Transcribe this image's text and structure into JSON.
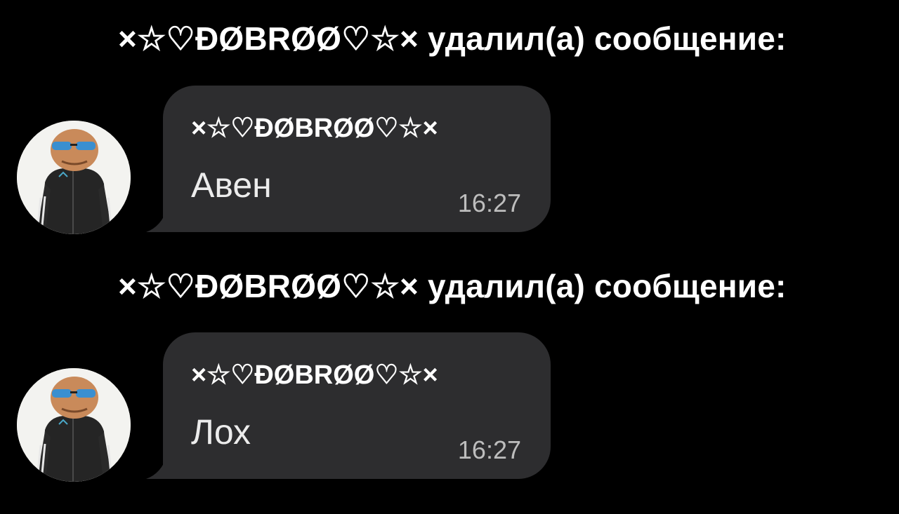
{
  "chat": {
    "events": [
      {
        "notice_text": "×☆♡ĐØBRØØ♡☆× удалил(а) сообщение:",
        "message": {
          "sender": "×☆♡ĐØBRØØ♡☆×",
          "text": "Авен",
          "time": "16:27"
        }
      },
      {
        "notice_text": "×☆♡ĐØBRØØ♡☆× удалил(а) сообщение:",
        "message": {
          "sender": "×☆♡ĐØBRØØ♡☆×",
          "text": "Лох",
          "time": "16:27"
        }
      }
    ]
  },
  "theme": {
    "background": "#000000",
    "bubble": "#2d2d2f",
    "text": "#ffffff",
    "time": "#bdbdbd"
  },
  "icons": {
    "avatar": "user-avatar-photo"
  }
}
